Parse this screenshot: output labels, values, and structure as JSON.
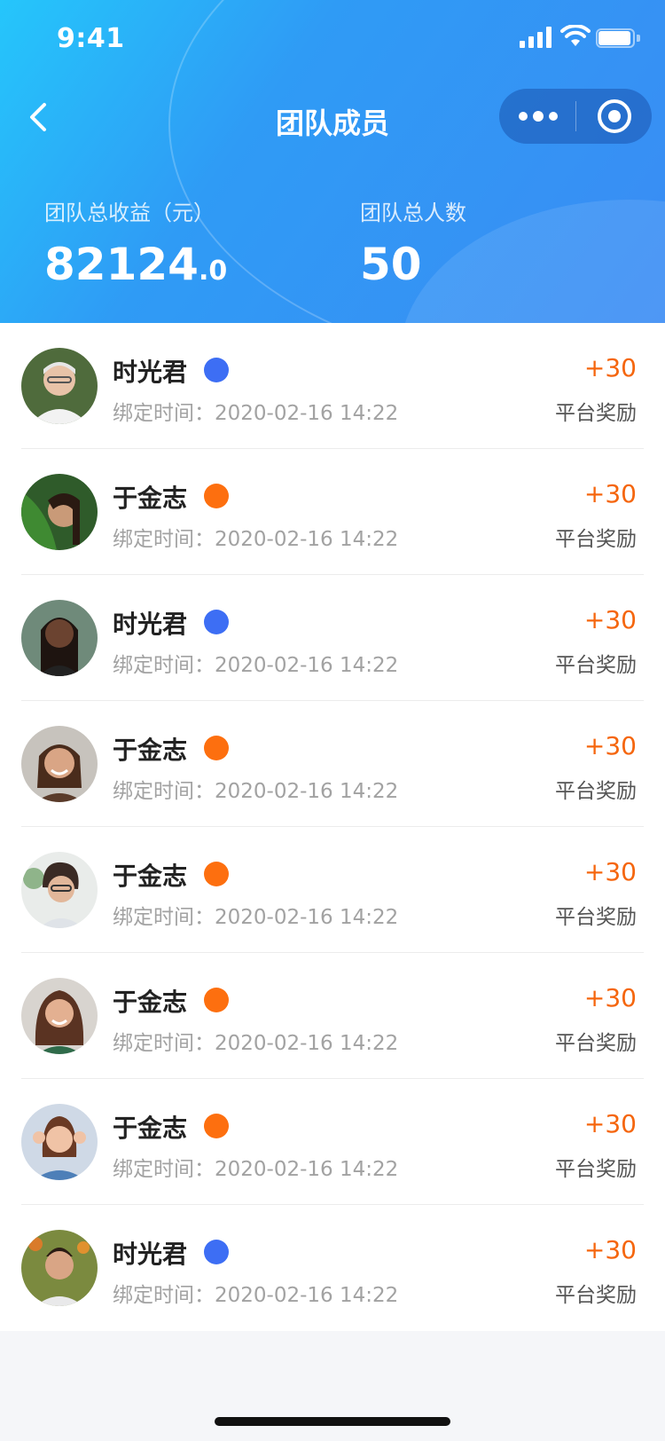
{
  "status_bar": {
    "time": "9:41"
  },
  "nav": {
    "title": "团队成员"
  },
  "stats": {
    "income_label": "团队总收益（元）",
    "income_integer": "82124",
    "income_decimal": ".0",
    "members_label": "团队总人数",
    "members_value": "50"
  },
  "members": [
    {
      "name": "时光君",
      "bind_label": "绑定时间：",
      "bind_time": "2020-02-16 14:22",
      "amount": "+30",
      "reward": "平台奖励",
      "dot_color": "#3d6ef4"
    },
    {
      "name": "于金志",
      "bind_label": "绑定时间：",
      "bind_time": "2020-02-16 14:22",
      "amount": "+30",
      "reward": "平台奖励",
      "dot_color": "#fd6f0f"
    },
    {
      "name": "时光君",
      "bind_label": "绑定时间：",
      "bind_time": "2020-02-16 14:22",
      "amount": "+30",
      "reward": "平台奖励",
      "dot_color": "#3d6ef4"
    },
    {
      "name": "于金志",
      "bind_label": "绑定时间：",
      "bind_time": "2020-02-16 14:22",
      "amount": "+30",
      "reward": "平台奖励",
      "dot_color": "#fd6f0f"
    },
    {
      "name": "于金志",
      "bind_label": "绑定时间：",
      "bind_time": "2020-02-16 14:22",
      "amount": "+30",
      "reward": "平台奖励",
      "dot_color": "#fd6f0f"
    },
    {
      "name": "于金志",
      "bind_label": "绑定时间：",
      "bind_time": "2020-02-16 14:22",
      "amount": "+30",
      "reward": "平台奖励",
      "dot_color": "#fd6f0f"
    },
    {
      "name": "于金志",
      "bind_label": "绑定时间：",
      "bind_time": "2020-02-16 14:22",
      "amount": "+30",
      "reward": "平台奖励",
      "dot_color": "#fd6f0f"
    },
    {
      "name": "时光君",
      "bind_label": "绑定时间：",
      "bind_time": "2020-02-16 14:22",
      "amount": "+30",
      "reward": "平台奖励",
      "dot_color": "#3d6ef4"
    }
  ],
  "colors": {
    "header_start": "#25c6fb",
    "header_end": "#3a8cf4",
    "amount": "#f5660e",
    "dot_blue": "#3d6ef4",
    "dot_orange": "#fd6f0f"
  },
  "icons": {
    "back": "chevron-left-icon",
    "more": "more-dots-icon",
    "close": "target-circle-icon"
  }
}
